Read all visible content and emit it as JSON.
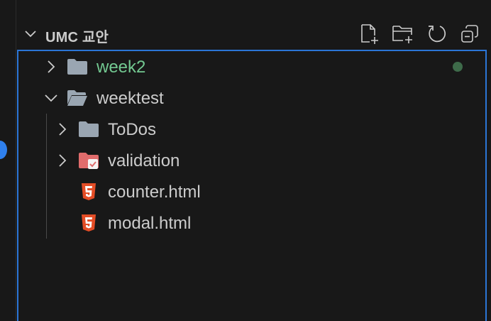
{
  "explorer": {
    "section_title": "UMC 교안",
    "actions": [
      {
        "name": "new-file",
        "icon": "new-file-icon"
      },
      {
        "name": "new-folder",
        "icon": "new-folder-icon"
      },
      {
        "name": "refresh",
        "icon": "refresh-icon"
      },
      {
        "name": "collapse-all",
        "icon": "collapse-all-icon"
      }
    ],
    "tree": {
      "items": [
        {
          "label": "week2",
          "type": "folder",
          "expanded": false,
          "level": 0,
          "label_color": "#73c991",
          "status_dot_color": "#3e6b4a"
        },
        {
          "label": "weektest",
          "type": "folder",
          "expanded": true,
          "level": 0
        },
        {
          "label": "ToDos",
          "type": "folder",
          "expanded": false,
          "level": 1
        },
        {
          "label": "validation",
          "type": "folder-special",
          "expanded": false,
          "level": 1
        },
        {
          "label": "counter.html",
          "type": "html-file",
          "level": 1
        },
        {
          "label": "modal.html",
          "type": "html-file",
          "level": 1
        }
      ]
    }
  },
  "colors": {
    "accent": "#2b75d6",
    "folder": "#9aa6b2",
    "html": "#e44d26",
    "validation_folder": "#e06c6c",
    "git_added": "#73c991"
  }
}
